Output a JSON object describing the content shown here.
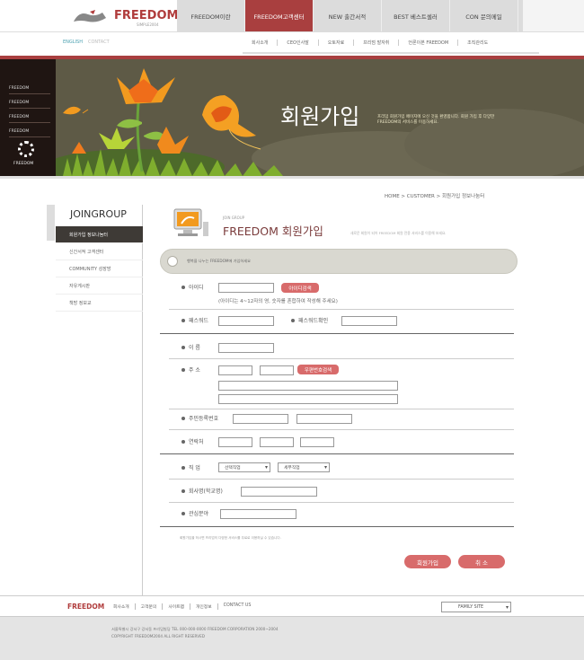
{
  "header": {
    "logo": "FREEDOM",
    "logo_sub": "SIMPLE2004",
    "gnb": [
      "FREEDOM이란",
      "FREEDOM고객센터",
      "NEW 출간서적",
      "BEST 베스트셀러",
      "CON 문의메일"
    ],
    "gnb_active": 1,
    "lang": [
      "ENGLISH",
      "CONTACT"
    ],
    "snb": [
      "회사소개",
      "CEO인사말",
      "오토자료",
      "프리덤 발자취",
      "언론이본 FREEDOM",
      "조직관리도"
    ]
  },
  "visual": {
    "tabs": [
      "FREEDOM",
      "FREEDOM",
      "FREEDOM",
      "FREEDOM"
    ],
    "mark": "FREEDOM",
    "title": "회원가입",
    "copy": "프리덤 회원가입 페이지에 오신 것을 환영합니다. 회원 가입 후 다양한 FREEDOM의 서비스를 이용하세요."
  },
  "sidebar": {
    "title": "JOINGROUP",
    "items": [
      "회원가입 정보나눔터",
      "신간서적 고객센터",
      "COMMUNITY 성장방",
      "자유게시판",
      "책방 정보교"
    ]
  },
  "content": {
    "breadcrumb": "HOME > CUSTOMER > 회원가입 정보나눔터",
    "small": "JOIN GROUP",
    "title": "FREEDOM 회원가입",
    "desc": "새로운 회원이 되어 FREEDOM 회원 전용 서비스를 이용해 보세요.",
    "pill": "행복을 나누는 FREEDOM에 가입하세요",
    "labels": {
      "id": "아이디",
      "id_hint": "(아이디는 4~12자의 영, 숫자를 혼합하여 작성해 주세요)",
      "pw": "패스워드",
      "pw2": "패스워드확인",
      "name": "이 름",
      "addr": "주 소",
      "jumin": "주민등록번호",
      "phone": "연락처",
      "job": "직 업",
      "company": "회사명(학교명)",
      "interest": "관심분야"
    },
    "buttons": {
      "id_check": "아이디검색",
      "zip": "우편번호검색",
      "submit": "회원가입",
      "cancel": "취 소"
    },
    "selects": {
      "job": "선택직업",
      "job_detail": "세부직업"
    },
    "notice": "회원가입을 하시면 프리덤의 다양한 서비스를 무료로 이용하실 수 있습니다."
  },
  "footer": {
    "logo": "FREEDOM",
    "links": [
      "회사소개",
      "고객문의",
      "사이트맵",
      "개인정보",
      "CONTACT US"
    ],
    "family": "FAMILY SITE",
    "addr1": "서울특별시 강서구 강서동 프리덤빌딩 TEL 000-000-0000 FREEDOM CORPORATION 2000~2004",
    "addr2": "COPYRIGHT FREEDOM2004 ALL RIGHT RESERVED"
  }
}
